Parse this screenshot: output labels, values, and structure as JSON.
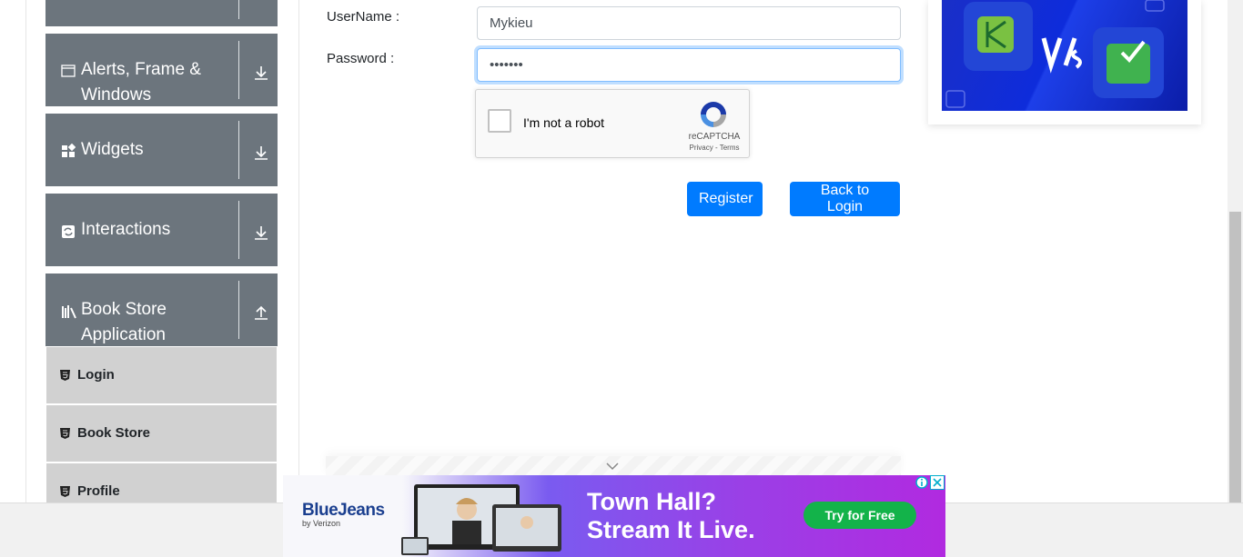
{
  "sidebar": {
    "groups": [
      {
        "label": "",
        "icon": "collapsed-group-icon"
      },
      {
        "label": "Alerts, Frame & Windows",
        "icon": "window-icon"
      },
      {
        "label": "Widgets",
        "icon": "widgets-icon"
      },
      {
        "label": "Interactions",
        "icon": "interactions-icon"
      },
      {
        "label": "Book Store Application",
        "icon": "books-icon"
      }
    ],
    "items": [
      {
        "label": "Login",
        "icon": "html5-icon"
      },
      {
        "label": "Book Store",
        "icon": "html5-icon"
      },
      {
        "label": "Profile",
        "icon": "html5-icon"
      }
    ]
  },
  "form": {
    "username_label": "UserName :",
    "username_value": "Mykieu",
    "password_label": "Password :",
    "password_value": "•••••••"
  },
  "captcha": {
    "label": "I'm not a robot",
    "brand": "reCAPTCHA",
    "terms": "Privacy - Terms"
  },
  "buttons": {
    "register": "Register",
    "back_to_login": "Back to Login"
  },
  "ad": {
    "brand": "BlueJeans",
    "brand_sub": "by Verizon",
    "headline_line1": "Town Hall?",
    "headline_line2": "Stream It Live.",
    "cta": "Try for Free"
  },
  "colors": {
    "sidebar_group": "#6c757d",
    "sidebar_item": "#d1d1d1",
    "primary": "#007bff",
    "cta_green": "#13b34a"
  }
}
